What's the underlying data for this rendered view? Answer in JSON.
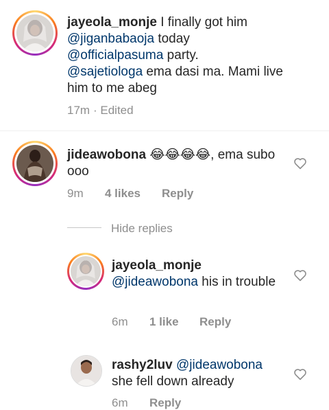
{
  "comments": [
    {
      "username": "jayeola_monje",
      "text_parts": [
        {
          "t": " I finally got him ",
          "type": "text"
        },
        {
          "t": "@jiganbabaoja",
          "type": "mention"
        },
        {
          "t": " today ",
          "type": "text"
        },
        {
          "t": "@officialpasuma",
          "type": "mention"
        },
        {
          "t": " party. ",
          "type": "text"
        },
        {
          "t": "@sajetiologa",
          "type": "mention"
        },
        {
          "t": " ema dasi ma. Mami live him to me abeg",
          "type": "text"
        }
      ],
      "time": "17m",
      "edited": "· Edited"
    },
    {
      "username": "jideawobona",
      "emoji": "😂😂😂😂",
      "text_after": ", ema subo ooo",
      "time": "9m",
      "likes": "4 likes",
      "reply": "Reply",
      "hide_replies": "Hide replies"
    }
  ],
  "replies": [
    {
      "username": "jayeola_monje",
      "mention": "@jideawobona",
      "text": " his in trouble",
      "time": "6m",
      "likes": "1 like",
      "reply": "Reply"
    },
    {
      "username": "rashy2luv",
      "mention": "@jideawobona",
      "text": "she fell down already",
      "time": "6m",
      "reply": "Reply"
    }
  ],
  "colors": {
    "mention": "#00376b",
    "meta": "#8e8e8e",
    "text": "#262626"
  },
  "icons": {
    "like": "heart-outline-icon"
  }
}
